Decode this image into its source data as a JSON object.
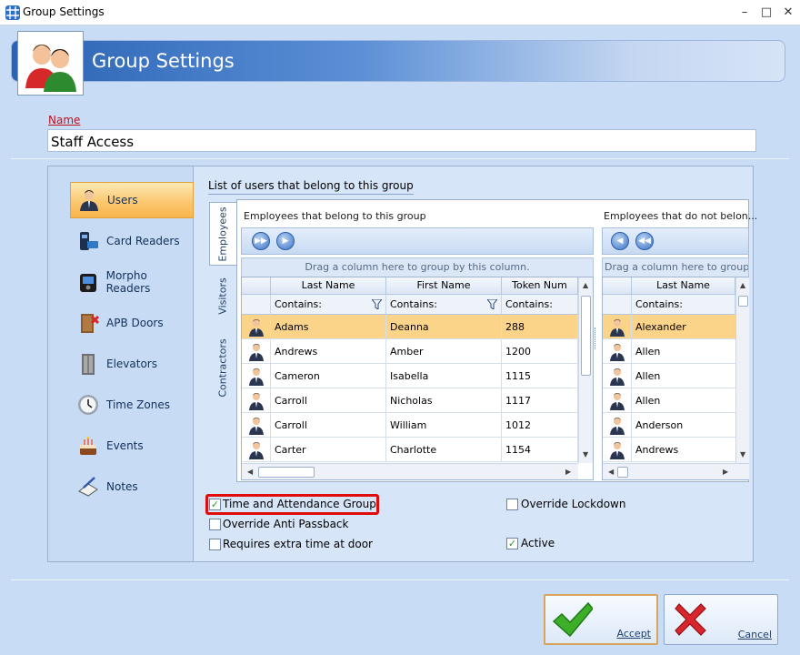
{
  "window": {
    "title": "Group Settings",
    "controls": {
      "minimize": "–",
      "maximize": "□",
      "close": "✕"
    }
  },
  "banner": {
    "title": "Group Settings"
  },
  "name": {
    "label": "Name",
    "value": "Staff Access"
  },
  "sidebar": {
    "items": [
      {
        "label": "Users",
        "icon": "user-icon",
        "selected": true
      },
      {
        "label": "Card Readers",
        "icon": "card-reader-icon"
      },
      {
        "label": "Morpho Readers",
        "icon": "morpho-reader-icon"
      },
      {
        "label": "APB Doors",
        "icon": "apb-door-icon"
      },
      {
        "label": "Elevators",
        "icon": "elevator-icon"
      },
      {
        "label": "Time Zones",
        "icon": "clock-icon"
      },
      {
        "label": "Events",
        "icon": "cake-icon"
      },
      {
        "label": "Notes",
        "icon": "notes-icon"
      }
    ]
  },
  "users": {
    "list_title": "List of users that belong to this group",
    "tabs": [
      "Employees",
      "Visitors",
      "Contractors"
    ],
    "left": {
      "title": "Employees that belong to this group",
      "drag_hint": "Drag a column here to group by this column.",
      "columns": [
        "Last Name",
        "First Name",
        "Token Num"
      ],
      "filters": [
        "Contains:",
        "Contains:",
        "Contains:"
      ],
      "rows": [
        {
          "last": "Adams",
          "first": "Deanna",
          "token": "288",
          "selected": true
        },
        {
          "last": "Andrews",
          "first": "Amber",
          "token": "1200"
        },
        {
          "last": "Cameron",
          "first": "Isabella",
          "token": "1115"
        },
        {
          "last": "Carroll",
          "first": "Nicholas",
          "token": "1117"
        },
        {
          "last": "Carroll",
          "first": "William",
          "token": "1012"
        },
        {
          "last": "Carter",
          "first": "Charlotte",
          "token": "1154"
        }
      ]
    },
    "right": {
      "title": "Employees that do not belon...",
      "drag_hint": "Drag a column here to group b",
      "columns": [
        "Last Name"
      ],
      "filters": [
        "Contains:"
      ],
      "rows": [
        {
          "last": "Alexander",
          "selected": true
        },
        {
          "last": "Allen"
        },
        {
          "last": "Allen"
        },
        {
          "last": "Allen"
        },
        {
          "last": "Anderson"
        },
        {
          "last": "Andrews"
        }
      ]
    }
  },
  "options": {
    "time_attendance": {
      "label": "Time and Attendance Group",
      "checked": true
    },
    "override_anti_passback": {
      "label": "Override Anti Passback",
      "checked": false
    },
    "extra_time": {
      "label": "Requires extra time at door",
      "checked": false
    },
    "override_lockdown": {
      "label": "Override Lockdown",
      "checked": false
    },
    "active": {
      "label": "Active",
      "checked": true
    },
    "check_mark": "✓"
  },
  "buttons": {
    "accept": "Accept",
    "cancel": "Cancel"
  },
  "colors": {
    "accent_red": "#e00b0b",
    "selection": "#fbd48a",
    "accept_green": "#3cae28",
    "cancel_red": "#d8262c"
  }
}
